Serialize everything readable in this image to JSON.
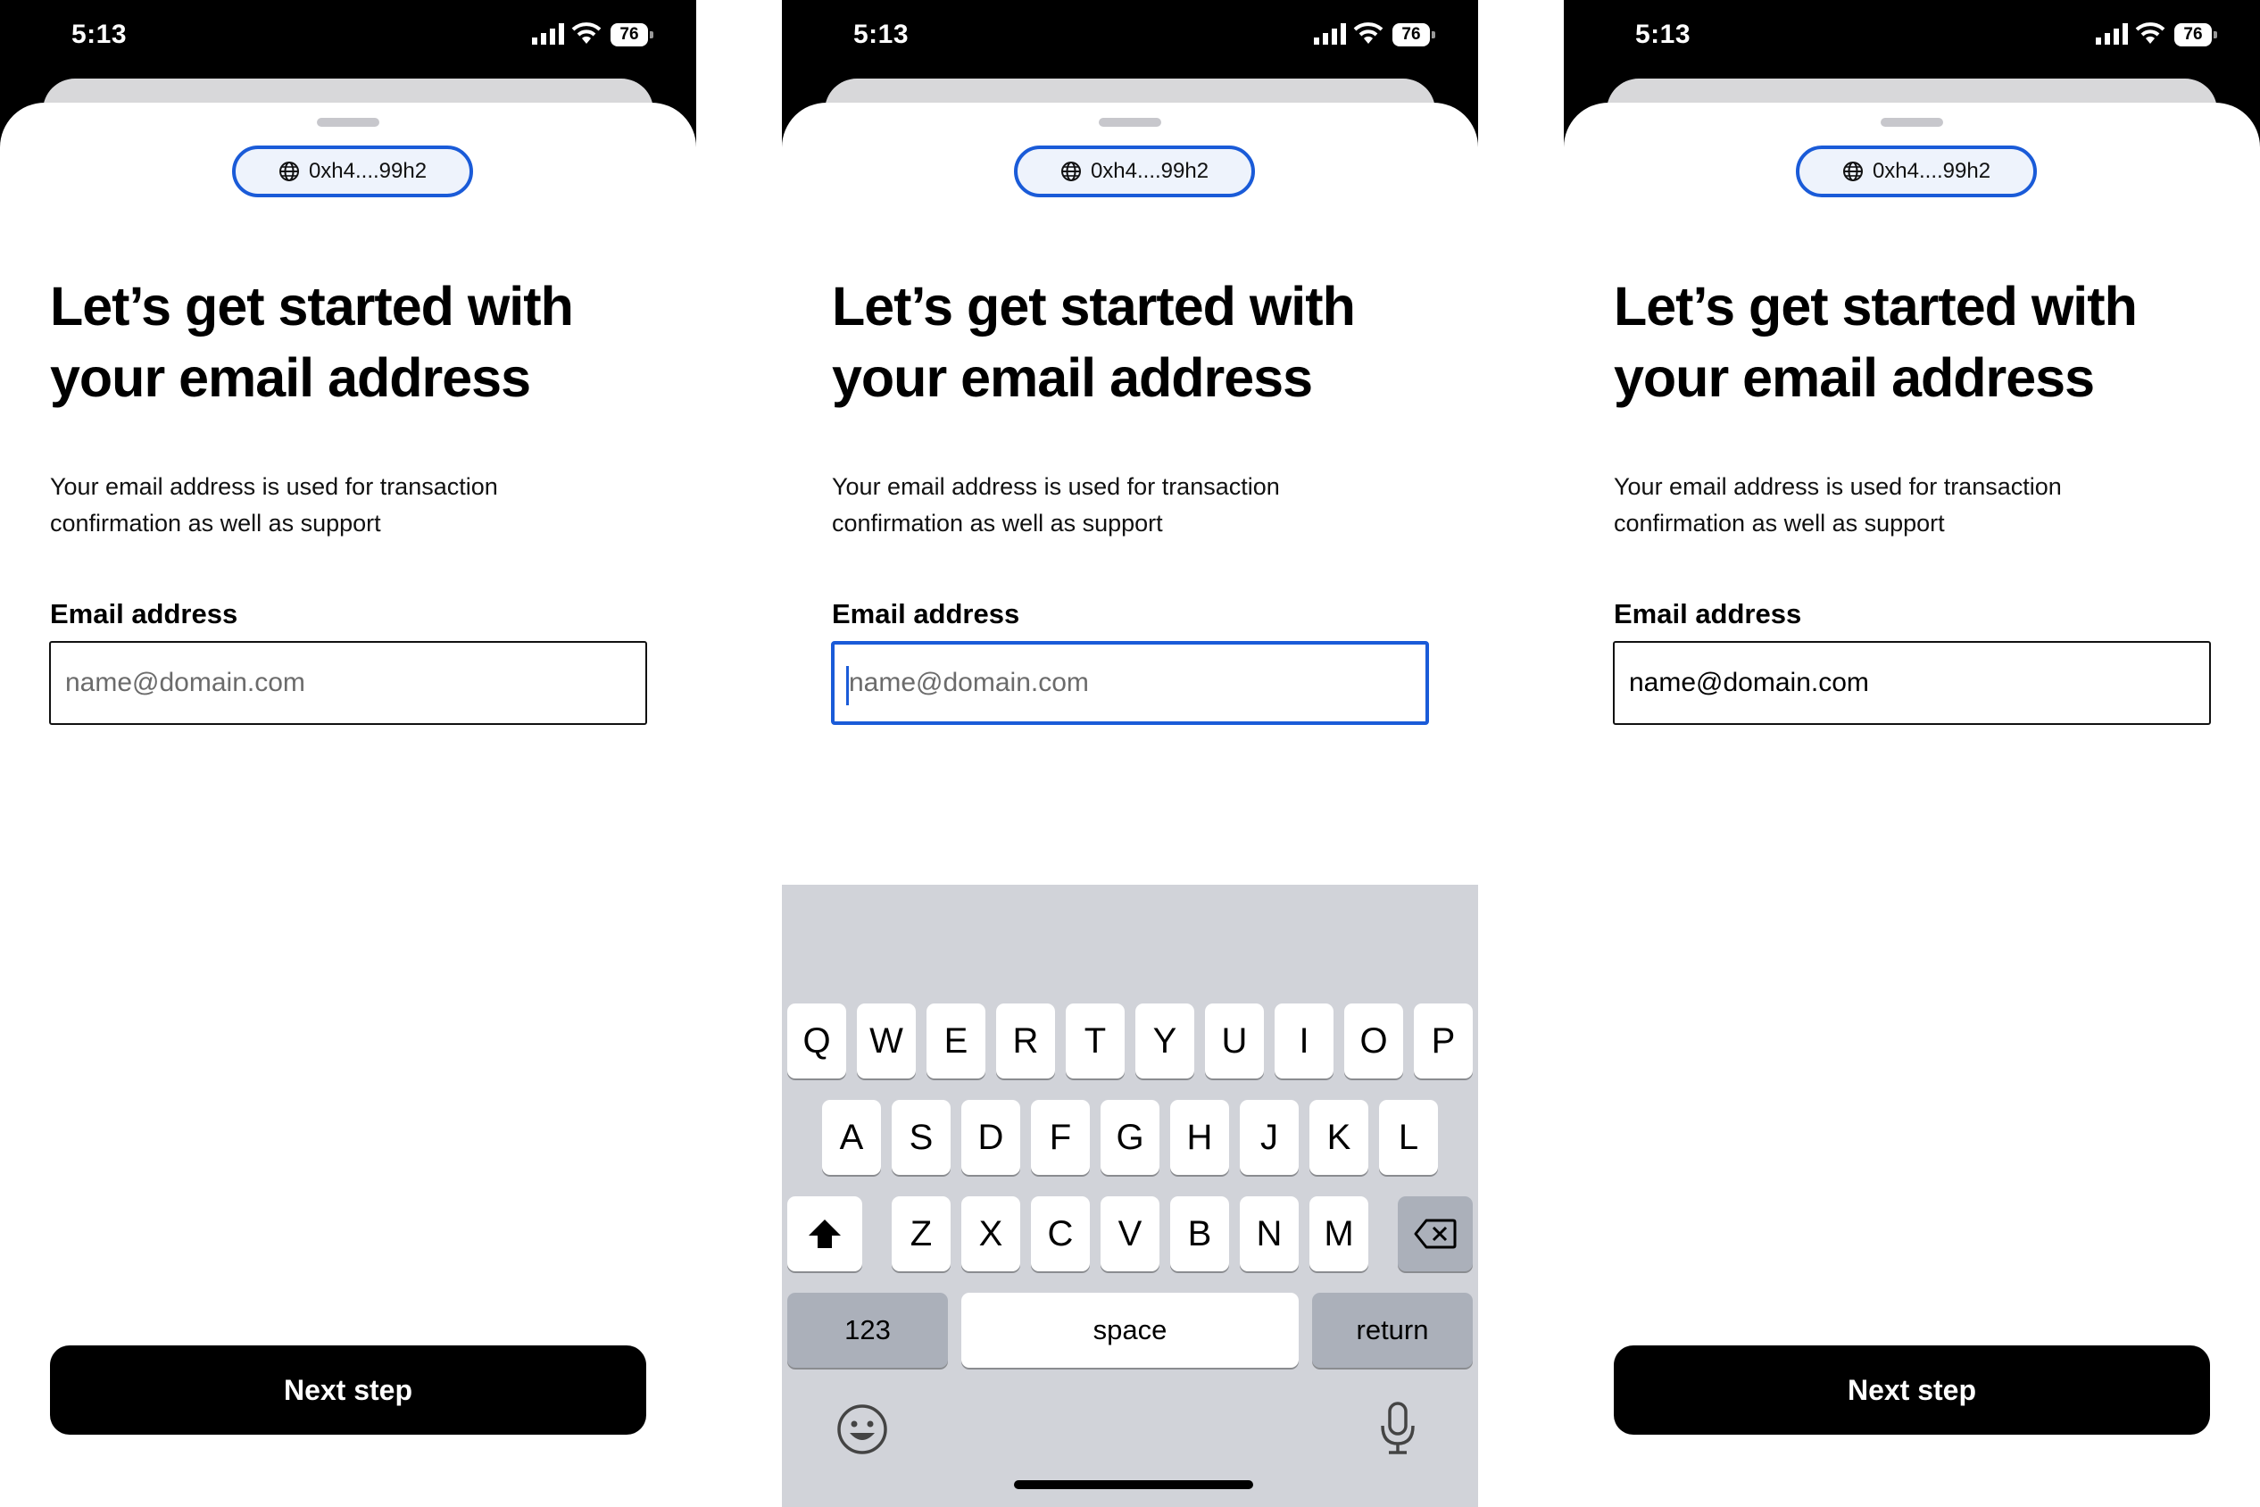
{
  "status_bar": {
    "time": "5:13",
    "battery": "76"
  },
  "wallet_pill": {
    "address": "0xh4....99h2",
    "icon": "globe-icon"
  },
  "title": "Let’s get started with your email address",
  "description": "Your email address is used for transaction confirmation as well as support",
  "email": {
    "label": "Email address",
    "placeholder": "name@domain.com",
    "filled_value": "name@domain.com"
  },
  "next_button": "Next step",
  "keyboard": {
    "row1": [
      "Q",
      "W",
      "E",
      "R",
      "T",
      "Y",
      "U",
      "I",
      "O",
      "P"
    ],
    "row2": [
      "A",
      "S",
      "D",
      "F",
      "G",
      "H",
      "J",
      "K",
      "L"
    ],
    "row3": [
      "Z",
      "X",
      "C",
      "V",
      "B",
      "N",
      "M"
    ],
    "numbers": "123",
    "space": "space",
    "return": "return",
    "icons": [
      "shift-icon",
      "backspace-icon",
      "emoji-icon",
      "microphone-icon"
    ]
  },
  "colors": {
    "accent": "#1a5bd8",
    "button": "#000000",
    "keyboard_bg": "#d1d3d9",
    "dark_key": "#abb0ba"
  }
}
